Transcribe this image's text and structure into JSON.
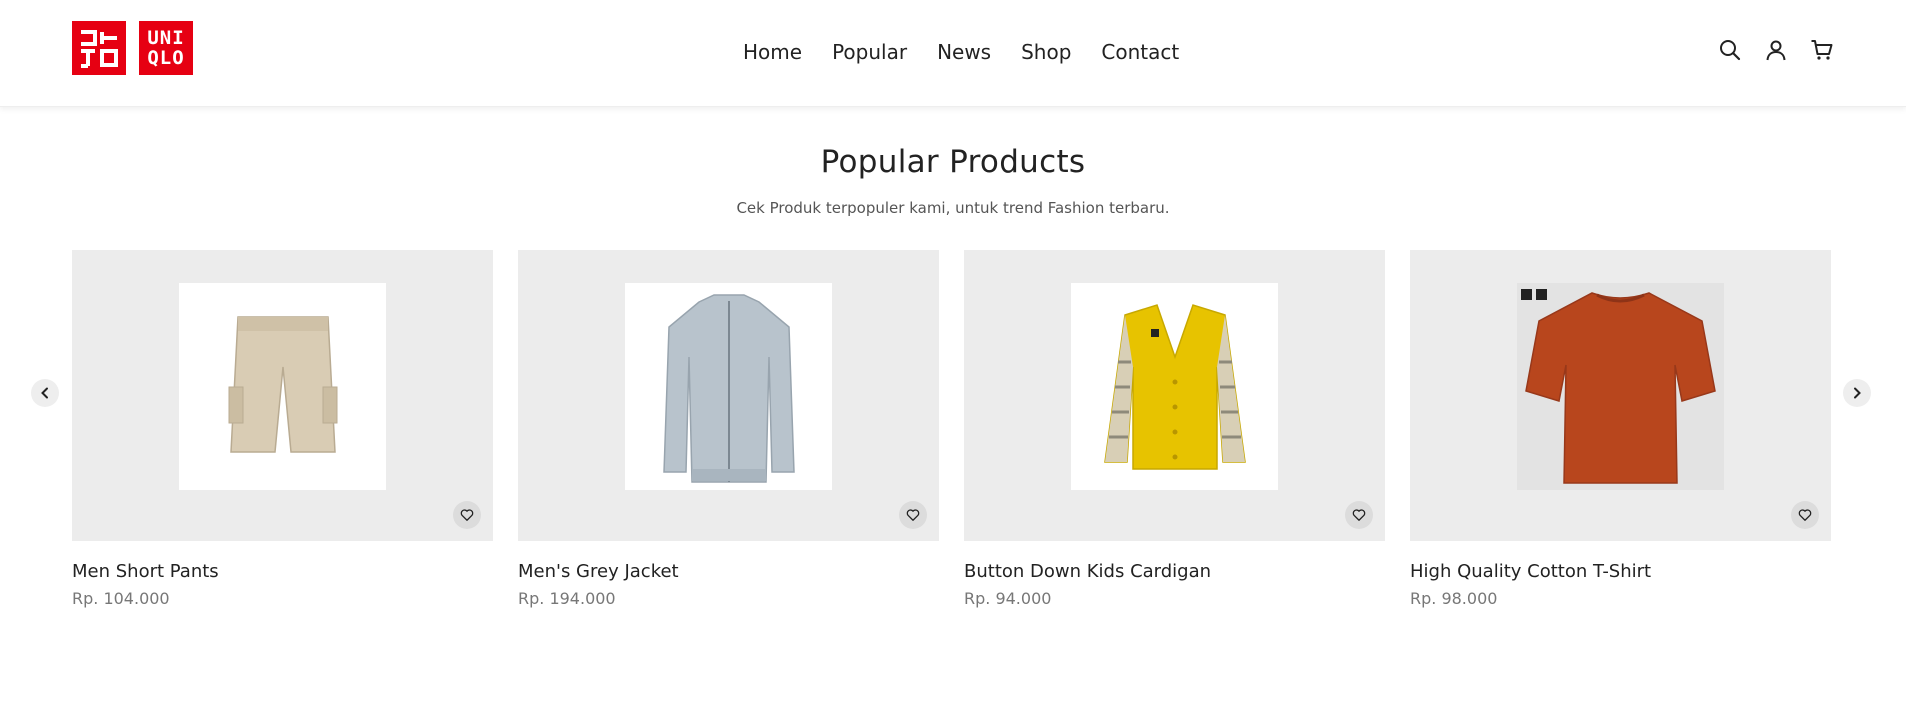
{
  "brand": {
    "logo_katakana": "ユニクロ",
    "logo_latin_line1": "UNI",
    "logo_latin_line2": "QLO",
    "color": "#e60012"
  },
  "nav": {
    "items": [
      {
        "label": "Home"
      },
      {
        "label": "Popular"
      },
      {
        "label": "News"
      },
      {
        "label": "Shop"
      },
      {
        "label": "Contact"
      }
    ]
  },
  "header_icons": [
    "search-icon",
    "user-icon",
    "cart-icon"
  ],
  "section": {
    "title": "Popular Products",
    "subtitle": "Cek Produk terpopuler kami, untuk trend Fashion terbaru."
  },
  "products": [
    {
      "name": "Men Short Pants",
      "price": "Rp. 104.000",
      "image": "shorts-image"
    },
    {
      "name": "Men's Grey Jacket",
      "price": "Rp. 194.000",
      "image": "jacket-image"
    },
    {
      "name": "Button Down Kids Cardigan",
      "price": "Rp. 94.000",
      "image": "cardigan-image"
    },
    {
      "name": "High Quality Cotton T-Shirt",
      "price": "Rp. 98.000",
      "image": "tshirt-image"
    }
  ],
  "colors": {
    "card_bg": "#ececec",
    "shorts": "#d9ccb4",
    "jacket": "#b8c3cc",
    "cardigan": "#e7c300",
    "tshirt": "#b8461d"
  }
}
